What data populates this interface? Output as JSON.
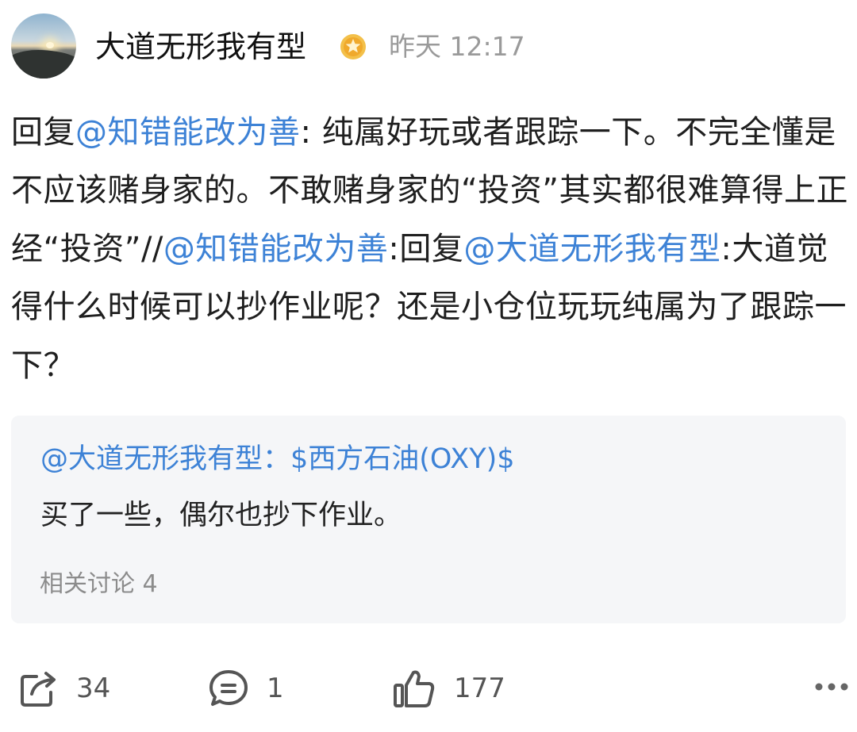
{
  "post": {
    "username": "大道无形我有型",
    "time": "昨天 12:17",
    "content": [
      {
        "text": "回复",
        "mention": false
      },
      {
        "text": "@知错能改为善",
        "mention": true
      },
      {
        "text": ": 纯属好玩或者跟踪一下。不完全懂是不应该赌身家的。不敢赌身家的“投资”其实都很难算得上正经“投资”//",
        "mention": false
      },
      {
        "text": "@知错能改为善",
        "mention": true
      },
      {
        "text": ":回复",
        "mention": false
      },
      {
        "text": "@大道无形我有型",
        "mention": true
      },
      {
        "text": ":大道觉得什么时候可以抄作业呢？还是小仓位玩玩纯属为了跟踪一下？",
        "mention": false
      }
    ]
  },
  "quote": {
    "header": "@大道无形我有型：$西方石油(OXY)$",
    "text": "买了一些，偶尔也抄下作业。",
    "related": "相关讨论 4"
  },
  "actions": {
    "share_count": "34",
    "comment_count": "1",
    "like_count": "177"
  },
  "colors": {
    "mention": "#3d82d6",
    "badge": "#f0b53a",
    "quote_bg": "#f5f6f8"
  },
  "icons": [
    "avatar",
    "verified-badge-icon",
    "share-icon",
    "comment-icon",
    "like-icon",
    "more-icon"
  ]
}
